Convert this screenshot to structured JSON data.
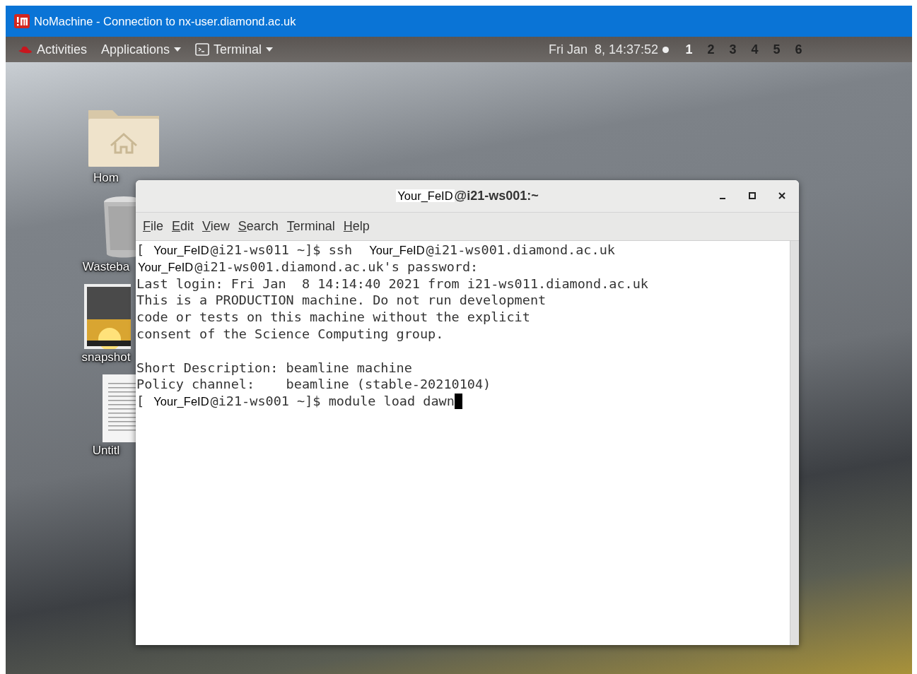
{
  "window": {
    "title": "NoMachine - Connection to nx-user.diamond.ac.uk"
  },
  "top_bar": {
    "activities": "Activities",
    "applications": "Applications",
    "app_menu": "Terminal",
    "clock": "Fri Jan  8, 14:37:52",
    "workspaces": [
      {
        "label": "1",
        "selected": true
      },
      {
        "label": "2",
        "selected": false
      },
      {
        "label": "3",
        "selected": false
      },
      {
        "label": "4",
        "selected": false
      },
      {
        "label": "5",
        "selected": false
      },
      {
        "label": "6",
        "selected": false
      }
    ]
  },
  "desktop_icons": [
    {
      "kind": "folder",
      "label": "Hom"
    },
    {
      "kind": "trash",
      "label": "Wasteba"
    },
    {
      "kind": "image",
      "label": "snapshot"
    },
    {
      "kind": "document",
      "label": "Untitl"
    }
  ],
  "terminal": {
    "title": [
      {
        "kind": "redacted",
        "text": "Your_FeID"
      },
      {
        "kind": "text",
        "text": "@i21-ws001:~"
      }
    ],
    "menu": [
      "File",
      "Edit",
      "View",
      "Search",
      "Terminal",
      "Help"
    ],
    "lines": [
      [
        {
          "kind": "text",
          "text": "[ "
        },
        {
          "kind": "redacted",
          "text": "Your_FeID"
        },
        {
          "kind": "text",
          "text": "@i21-ws011 ~]$ ssh  "
        },
        {
          "kind": "redacted",
          "text": "Your_FeID"
        },
        {
          "kind": "text",
          "text": "@i21-ws001.diamond.ac.uk"
        }
      ],
      [
        {
          "kind": "redacted",
          "text": "Your_FeID"
        },
        {
          "kind": "text",
          "text": "@i21-ws001.diamond.ac.uk's password:"
        }
      ],
      [
        {
          "kind": "text",
          "text": "Last login: Fri Jan  8 14:14:40 2021 from i21-ws011.diamond.ac.uk"
        }
      ],
      [
        {
          "kind": "text",
          "text": "This is a PRODUCTION machine. Do not run development"
        }
      ],
      [
        {
          "kind": "text",
          "text": "code or tests on this machine without the explicit"
        }
      ],
      [
        {
          "kind": "text",
          "text": "consent of the Science Computing group."
        }
      ],
      [
        {
          "kind": "blank"
        }
      ],
      [
        {
          "kind": "text",
          "text": "Short Description: beamline machine"
        }
      ],
      [
        {
          "kind": "text",
          "text": "Policy channel:    beamline (stable-20210104)"
        }
      ],
      [
        {
          "kind": "text",
          "text": "[ "
        },
        {
          "kind": "redacted",
          "text": "Your_FeID"
        },
        {
          "kind": "text",
          "text": "@i21-ws001 ~]$ module load dawn"
        }
      ]
    ]
  }
}
